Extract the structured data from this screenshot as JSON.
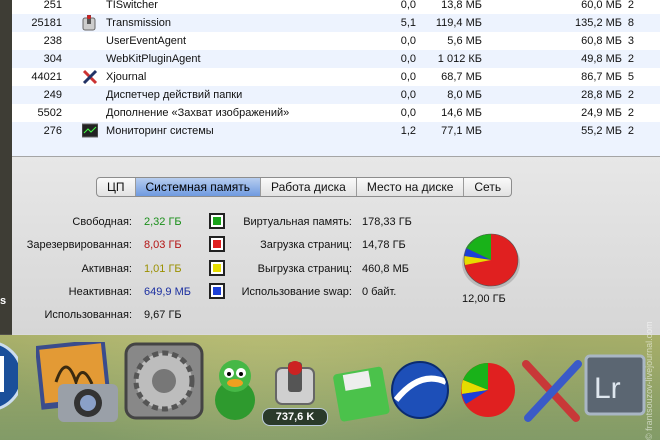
{
  "processes": [
    {
      "pid": "251",
      "name": "TISwitcher",
      "cpu": "0,0",
      "real_mem": "13,8 МБ",
      "virt_mem": "60,0 МБ",
      "threads": "2",
      "icon": "none"
    },
    {
      "pid": "25181",
      "name": "Transmission",
      "cpu": "5,1",
      "real_mem": "119,4 МБ",
      "virt_mem": "135,2 МБ",
      "threads": "8",
      "icon": "transmission-icon"
    },
    {
      "pid": "238",
      "name": "UserEventAgent",
      "cpu": "0,0",
      "real_mem": "5,6 МБ",
      "virt_mem": "60,8 МБ",
      "threads": "3",
      "icon": "none"
    },
    {
      "pid": "304",
      "name": "WebKitPluginAgent",
      "cpu": "0,0",
      "real_mem": "1 012 КБ",
      "virt_mem": "49,8 МБ",
      "threads": "2",
      "icon": "none"
    },
    {
      "pid": "44021",
      "name": "Xjournal",
      "cpu": "0,0",
      "real_mem": "68,7 МБ",
      "virt_mem": "86,7 МБ",
      "threads": "5",
      "icon": "xjournal-icon"
    },
    {
      "pid": "249",
      "name": "Диспетчер действий папки",
      "cpu": "0,0",
      "real_mem": "8,0 МБ",
      "virt_mem": "28,8 МБ",
      "threads": "2",
      "icon": "none"
    },
    {
      "pid": "5502",
      "name": "Дополнение «Захват изображений»",
      "cpu": "0,0",
      "real_mem": "14,6 МБ",
      "virt_mem": "24,9 МБ",
      "threads": "2",
      "icon": "none"
    },
    {
      "pid": "276",
      "name": "Мониторинг системы",
      "cpu": "1,2",
      "real_mem": "77,1 МБ",
      "virt_mem": "55,2 МБ",
      "threads": "2",
      "icon": "activity-monitor-icon"
    }
  ],
  "tabs": [
    {
      "label": "ЦП",
      "active": false
    },
    {
      "label": "Системная память",
      "active": true
    },
    {
      "label": "Работа диска",
      "active": false
    },
    {
      "label": "Место на диске",
      "active": false
    },
    {
      "label": "Сеть",
      "active": false
    }
  ],
  "memory": {
    "free_label": "Свободная:",
    "free_value": "2,32 ГБ",
    "free_color": "#1aa31a",
    "wired_label": "Зарезервированная:",
    "wired_value": "8,03 ГБ",
    "wired_color": "#e02020",
    "active_label": "Активная:",
    "active_value": "1,01 ГБ",
    "active_color": "#d6cc00",
    "inactive_label": "Неактивная:",
    "inactive_value": "649,9 МБ",
    "inactive_color": "#1b3fd8",
    "used_label": "Использованная:",
    "used_value": "9,67 ГБ"
  },
  "vm": {
    "virtual_label": "Виртуальная память:",
    "virtual_value": "178,33 ГБ",
    "pagein_label": "Загрузка страниц:",
    "pagein_value": "14,78 ГБ",
    "pageout_label": "Выгрузка страниц:",
    "pageout_value": "460,8 МБ",
    "swap_label": "Использование swap:",
    "swap_value": "0 байт."
  },
  "total_memory": "12,00 ГБ",
  "dock": {
    "transmission_badge": "737,6 K",
    "left_edge_badge": "s"
  },
  "watermark": "© frantsouzov-livejournal.com"
}
